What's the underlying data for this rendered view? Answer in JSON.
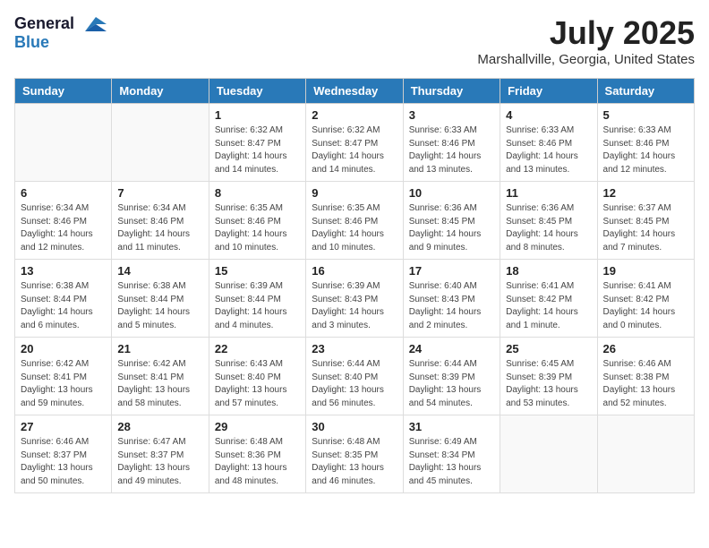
{
  "logo": {
    "general": "General",
    "blue": "Blue"
  },
  "title": "July 2025",
  "location": "Marshallville, Georgia, United States",
  "days_of_week": [
    "Sunday",
    "Monday",
    "Tuesday",
    "Wednesday",
    "Thursday",
    "Friday",
    "Saturday"
  ],
  "weeks": [
    [
      {
        "day": "",
        "sunrise": "",
        "sunset": "",
        "daylight": ""
      },
      {
        "day": "",
        "sunrise": "",
        "sunset": "",
        "daylight": ""
      },
      {
        "day": "1",
        "sunrise": "Sunrise: 6:32 AM",
        "sunset": "Sunset: 8:47 PM",
        "daylight": "Daylight: 14 hours and 14 minutes."
      },
      {
        "day": "2",
        "sunrise": "Sunrise: 6:32 AM",
        "sunset": "Sunset: 8:47 PM",
        "daylight": "Daylight: 14 hours and 14 minutes."
      },
      {
        "day": "3",
        "sunrise": "Sunrise: 6:33 AM",
        "sunset": "Sunset: 8:46 PM",
        "daylight": "Daylight: 14 hours and 13 minutes."
      },
      {
        "day": "4",
        "sunrise": "Sunrise: 6:33 AM",
        "sunset": "Sunset: 8:46 PM",
        "daylight": "Daylight: 14 hours and 13 minutes."
      },
      {
        "day": "5",
        "sunrise": "Sunrise: 6:33 AM",
        "sunset": "Sunset: 8:46 PM",
        "daylight": "Daylight: 14 hours and 12 minutes."
      }
    ],
    [
      {
        "day": "6",
        "sunrise": "Sunrise: 6:34 AM",
        "sunset": "Sunset: 8:46 PM",
        "daylight": "Daylight: 14 hours and 12 minutes."
      },
      {
        "day": "7",
        "sunrise": "Sunrise: 6:34 AM",
        "sunset": "Sunset: 8:46 PM",
        "daylight": "Daylight: 14 hours and 11 minutes."
      },
      {
        "day": "8",
        "sunrise": "Sunrise: 6:35 AM",
        "sunset": "Sunset: 8:46 PM",
        "daylight": "Daylight: 14 hours and 10 minutes."
      },
      {
        "day": "9",
        "sunrise": "Sunrise: 6:35 AM",
        "sunset": "Sunset: 8:46 PM",
        "daylight": "Daylight: 14 hours and 10 minutes."
      },
      {
        "day": "10",
        "sunrise": "Sunrise: 6:36 AM",
        "sunset": "Sunset: 8:45 PM",
        "daylight": "Daylight: 14 hours and 9 minutes."
      },
      {
        "day": "11",
        "sunrise": "Sunrise: 6:36 AM",
        "sunset": "Sunset: 8:45 PM",
        "daylight": "Daylight: 14 hours and 8 minutes."
      },
      {
        "day": "12",
        "sunrise": "Sunrise: 6:37 AM",
        "sunset": "Sunset: 8:45 PM",
        "daylight": "Daylight: 14 hours and 7 minutes."
      }
    ],
    [
      {
        "day": "13",
        "sunrise": "Sunrise: 6:38 AM",
        "sunset": "Sunset: 8:44 PM",
        "daylight": "Daylight: 14 hours and 6 minutes."
      },
      {
        "day": "14",
        "sunrise": "Sunrise: 6:38 AM",
        "sunset": "Sunset: 8:44 PM",
        "daylight": "Daylight: 14 hours and 5 minutes."
      },
      {
        "day": "15",
        "sunrise": "Sunrise: 6:39 AM",
        "sunset": "Sunset: 8:44 PM",
        "daylight": "Daylight: 14 hours and 4 minutes."
      },
      {
        "day": "16",
        "sunrise": "Sunrise: 6:39 AM",
        "sunset": "Sunset: 8:43 PM",
        "daylight": "Daylight: 14 hours and 3 minutes."
      },
      {
        "day": "17",
        "sunrise": "Sunrise: 6:40 AM",
        "sunset": "Sunset: 8:43 PM",
        "daylight": "Daylight: 14 hours and 2 minutes."
      },
      {
        "day": "18",
        "sunrise": "Sunrise: 6:41 AM",
        "sunset": "Sunset: 8:42 PM",
        "daylight": "Daylight: 14 hours and 1 minute."
      },
      {
        "day": "19",
        "sunrise": "Sunrise: 6:41 AM",
        "sunset": "Sunset: 8:42 PM",
        "daylight": "Daylight: 14 hours and 0 minutes."
      }
    ],
    [
      {
        "day": "20",
        "sunrise": "Sunrise: 6:42 AM",
        "sunset": "Sunset: 8:41 PM",
        "daylight": "Daylight: 13 hours and 59 minutes."
      },
      {
        "day": "21",
        "sunrise": "Sunrise: 6:42 AM",
        "sunset": "Sunset: 8:41 PM",
        "daylight": "Daylight: 13 hours and 58 minutes."
      },
      {
        "day": "22",
        "sunrise": "Sunrise: 6:43 AM",
        "sunset": "Sunset: 8:40 PM",
        "daylight": "Daylight: 13 hours and 57 minutes."
      },
      {
        "day": "23",
        "sunrise": "Sunrise: 6:44 AM",
        "sunset": "Sunset: 8:40 PM",
        "daylight": "Daylight: 13 hours and 56 minutes."
      },
      {
        "day": "24",
        "sunrise": "Sunrise: 6:44 AM",
        "sunset": "Sunset: 8:39 PM",
        "daylight": "Daylight: 13 hours and 54 minutes."
      },
      {
        "day": "25",
        "sunrise": "Sunrise: 6:45 AM",
        "sunset": "Sunset: 8:39 PM",
        "daylight": "Daylight: 13 hours and 53 minutes."
      },
      {
        "day": "26",
        "sunrise": "Sunrise: 6:46 AM",
        "sunset": "Sunset: 8:38 PM",
        "daylight": "Daylight: 13 hours and 52 minutes."
      }
    ],
    [
      {
        "day": "27",
        "sunrise": "Sunrise: 6:46 AM",
        "sunset": "Sunset: 8:37 PM",
        "daylight": "Daylight: 13 hours and 50 minutes."
      },
      {
        "day": "28",
        "sunrise": "Sunrise: 6:47 AM",
        "sunset": "Sunset: 8:37 PM",
        "daylight": "Daylight: 13 hours and 49 minutes."
      },
      {
        "day": "29",
        "sunrise": "Sunrise: 6:48 AM",
        "sunset": "Sunset: 8:36 PM",
        "daylight": "Daylight: 13 hours and 48 minutes."
      },
      {
        "day": "30",
        "sunrise": "Sunrise: 6:48 AM",
        "sunset": "Sunset: 8:35 PM",
        "daylight": "Daylight: 13 hours and 46 minutes."
      },
      {
        "day": "31",
        "sunrise": "Sunrise: 6:49 AM",
        "sunset": "Sunset: 8:34 PM",
        "daylight": "Daylight: 13 hours and 45 minutes."
      },
      {
        "day": "",
        "sunrise": "",
        "sunset": "",
        "daylight": ""
      },
      {
        "day": "",
        "sunrise": "",
        "sunset": "",
        "daylight": ""
      }
    ]
  ]
}
